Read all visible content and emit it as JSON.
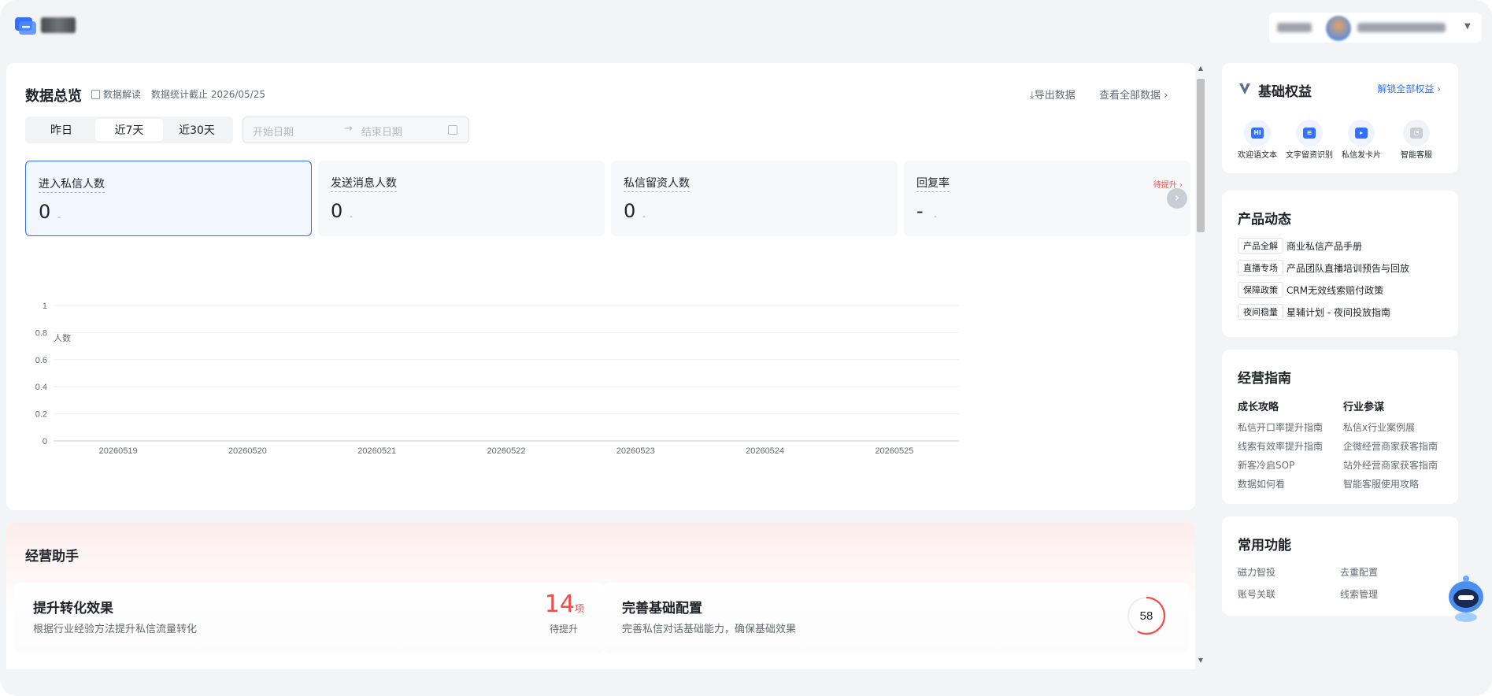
{
  "overview": {
    "title": "数据总览",
    "interpret_label": "数据解读",
    "data_date": "数据统计截止 2026/05/25",
    "export_label": "导出数据",
    "view_all_label": "查看全部数据",
    "ranges": [
      "昨日",
      "近7天",
      "近30天"
    ],
    "active_range": "近7天",
    "date_start_placeholder": "开始日期",
    "date_end_placeholder": "结束日期",
    "metrics": [
      {
        "label": "进入私信人数",
        "value": "0",
        "delta": "-"
      },
      {
        "label": "发送消息人数",
        "value": "0",
        "delta": "-"
      },
      {
        "label": "私信留资人数",
        "value": "0",
        "delta": "-"
      },
      {
        "label": "回复率",
        "value": "-",
        "delta": "-",
        "badge": "待提升"
      }
    ]
  },
  "chart_data": {
    "type": "line",
    "ylabel": "人数",
    "yticks": [
      "1",
      "0.8",
      "0.6",
      "0.4",
      "0.2",
      "0"
    ],
    "ylim": [
      0,
      1
    ],
    "categories": [
      "20260519",
      "20260520",
      "20260521",
      "20260522",
      "20260523",
      "20260524",
      "20260525"
    ],
    "series": [],
    "grid": true
  },
  "assistant": {
    "title": "经营助手",
    "cards": [
      {
        "title": "提升转化效果",
        "desc": "根据行业经验方法提升私信流量转化",
        "count": "14",
        "unit": "项",
        "pending": "待提升"
      },
      {
        "title": "完善基础配置",
        "desc": "完善私信对话基础能力，确保基础效果",
        "score": "58",
        "score_fraction": 0.58
      }
    ]
  },
  "rights": {
    "title": "基础权益",
    "link": "解锁全部权益",
    "items": [
      {
        "label": "欢迎语文本",
        "glyph": "Hi",
        "icon": "hi-chat-icon",
        "enabled": true
      },
      {
        "label": "文字留资识别",
        "glyph": "≡",
        "icon": "text-scan-icon",
        "enabled": true
      },
      {
        "label": "私信发卡片",
        "glyph": "▸",
        "icon": "card-send-icon",
        "enabled": true
      },
      {
        "label": "智能客服",
        "glyph": "◔",
        "icon": "headset-icon",
        "enabled": false
      }
    ]
  },
  "news": {
    "title": "产品动态",
    "items": [
      {
        "tag": "产品全解",
        "text": "商业私信产品手册"
      },
      {
        "tag": "直播专场",
        "text": "产品团队直播培训预告与回放"
      },
      {
        "tag": "保障政策",
        "text": "CRM无效线索赔付政策"
      },
      {
        "tag": "夜间稳量",
        "text": "星辅计划 - 夜间投放指南"
      }
    ]
  },
  "guide": {
    "title": "经营指南",
    "col1": {
      "heading": "成长攻略",
      "links": [
        "私信开口率提升指南",
        "线索有效率提升指南",
        "新客冷启SOP",
        "数据如何看"
      ]
    },
    "col2": {
      "heading": "行业参谋",
      "links": [
        "私信x行业案例展",
        "企微经营商家获客指南",
        "站外经营商家获客指南",
        "智能客服使用攻略"
      ]
    }
  },
  "common": {
    "title": "常用功能",
    "links": [
      "磁力智投",
      "去重配置",
      "账号关联",
      "线索管理"
    ]
  },
  "colors": {
    "accent": "#3370ff",
    "danger": "#f54a45",
    "page_bg": "#f3f4f6"
  }
}
